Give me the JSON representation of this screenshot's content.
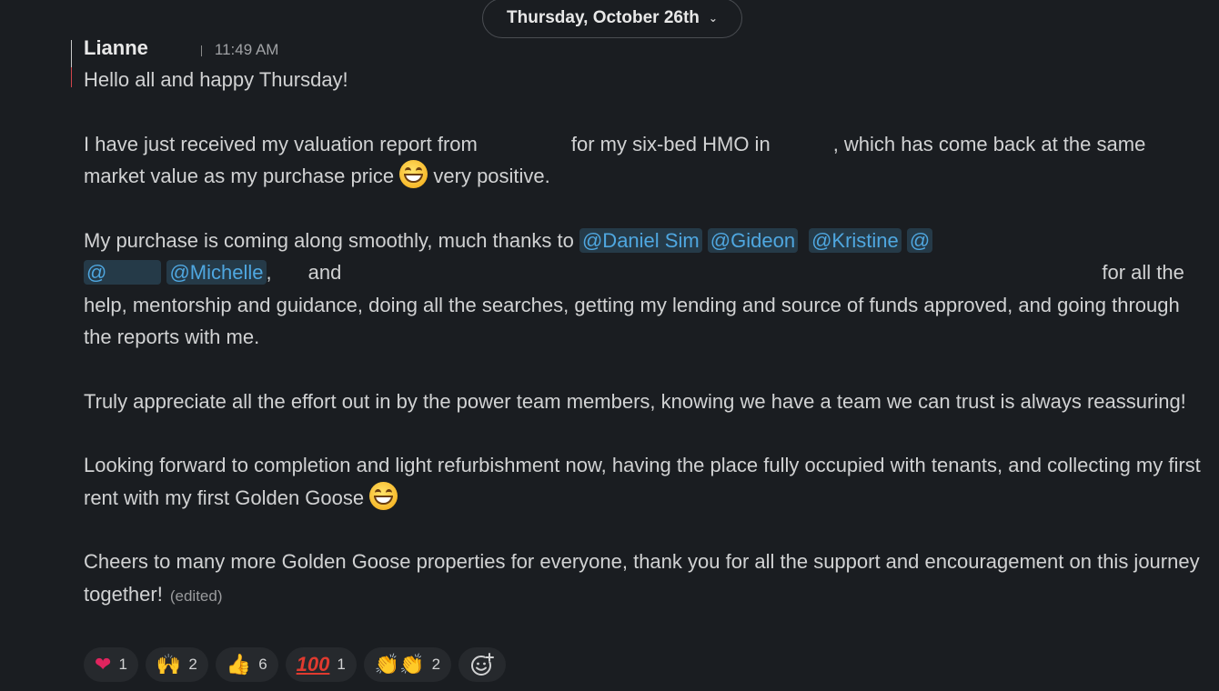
{
  "date_divider": {
    "label": "Thursday, October 26th",
    "chevron_icon": "chevron-down-icon"
  },
  "message": {
    "author": "Lianne",
    "time": "11:49 AM",
    "greeting": "Hello all and happy Thursday!",
    "p2": {
      "a": "I have just received my valuation report from",
      "b": "for my six-bed HMO in",
      "c": ", which has come back at the same market value as my purchase price",
      "d": "very positive."
    },
    "p3": {
      "a": "My purchase is coming along smoothly, much thanks to",
      "mentions": [
        "@Daniel Sim",
        "@Gideon",
        "@Kristine",
        "@",
        "@",
        "@Michelle"
      ],
      "comma": ",",
      "and": "and",
      "b": "for all the help, mentorship and guidance, doing all the searches, getting my lending and source of funds approved, and going through the reports with me."
    },
    "p4": "Truly appreciate all the effort out in by the power team members, knowing we have a team we can trust is always reassuring!",
    "p5": "Looking forward to completion and light refurbishment now, having the place fully occupied with tenants, and collecting my first rent with my first Golden Goose",
    "p6": "Cheers to many more Golden Goose properties for everyone, thank you for all the support and encouragement on this journey together!",
    "edited": "(edited)",
    "inline_emoji": "grinning-face-icon"
  },
  "reactions": [
    {
      "emoji": "❤️",
      "icon": "red-heart-icon",
      "count": "1"
    },
    {
      "emoji": "🙌",
      "icon": "raising-hands-icon",
      "count": "2"
    },
    {
      "emoji": "👍",
      "icon": "thumbs-up-icon",
      "count": "6"
    },
    {
      "emoji": "100",
      "icon": "hundred-points-icon",
      "count": "1"
    },
    {
      "emoji": "👏👏",
      "icon": "clapping-hands-icon",
      "count": "2"
    }
  ],
  "add_reaction": {
    "icon": "add-reaction-icon"
  },
  "colors": {
    "background": "#1a1d21",
    "mention_text": "#4fa7e0",
    "mention_bg": "#253a48",
    "reaction_bg": "#26292d"
  }
}
